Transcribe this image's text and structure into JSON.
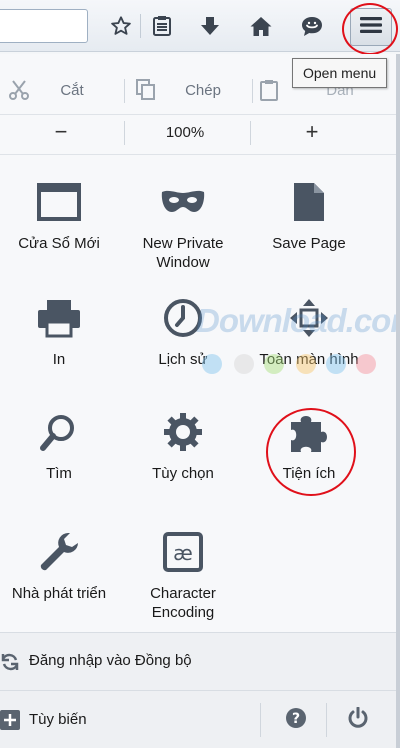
{
  "tooltip": {
    "text": "Open menu"
  },
  "toolbar": {
    "icons": [
      "star-icon",
      "reading-list-icon",
      "download-icon",
      "home-icon",
      "chat-icon",
      "hamburger-menu-icon"
    ]
  },
  "edit": {
    "cut_label": "Cắt",
    "copy_label": "Chép",
    "paste_label": "Dán"
  },
  "zoom": {
    "minus_label": "−",
    "level": "100%",
    "plus_label": "+"
  },
  "grid": [
    {
      "label": "Cửa Sổ Mới",
      "icon": "new-window-icon"
    },
    {
      "label": "New Private Window",
      "icon": "private-mask-icon"
    },
    {
      "label": "Save Page",
      "icon": "save-page-icon"
    },
    {
      "label": "In",
      "icon": "printer-icon"
    },
    {
      "label": "Lịch sử",
      "icon": "history-clock-icon"
    },
    {
      "label": "Toàn màn hình",
      "icon": "fullscreen-icon"
    },
    {
      "label": "Tìm",
      "icon": "find-magnifier-icon"
    },
    {
      "label": "Tùy chọn",
      "icon": "options-gear-icon"
    },
    {
      "label": "Tiện ích",
      "icon": "addons-puzzle-icon"
    },
    {
      "label": "Nhà phát triển",
      "icon": "developer-wrench-icon"
    },
    {
      "label": "Character Encoding",
      "icon": "character-encoding-icon"
    }
  ],
  "footer": {
    "sync_label": "Đăng nhập vào Đồng bộ",
    "customize_label": "Tùy biến"
  },
  "watermark": {
    "text": "Download.com.vn"
  },
  "colors": {
    "icon": "#4a5563",
    "highlight": "#e0101a",
    "accent": "#2a64b8"
  }
}
